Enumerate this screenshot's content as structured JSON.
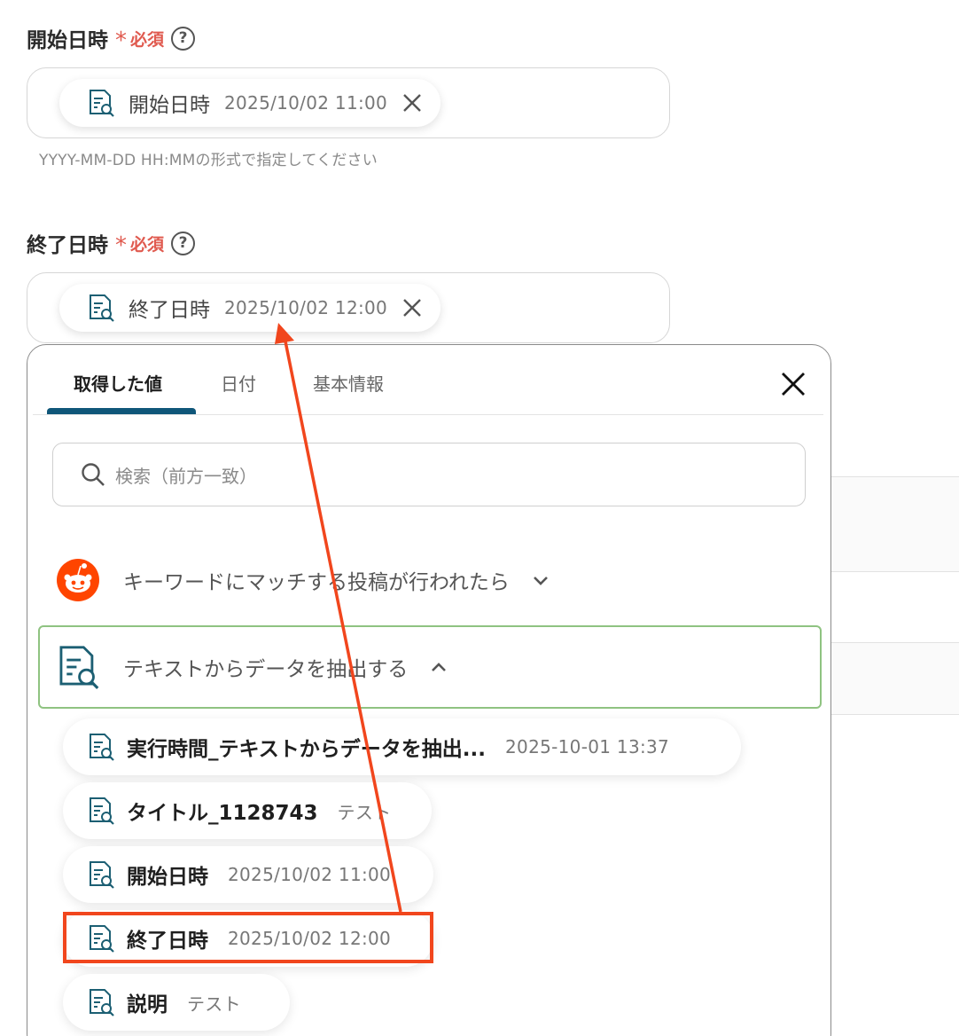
{
  "start_field": {
    "label": "開始日時",
    "required_mark": "*",
    "required_text": "必須",
    "help": "?",
    "chip_name": "開始日時",
    "chip_value": "2025/10/02 11:00",
    "hint": "YYYY-MM-DD HH:MMの形式で指定してください"
  },
  "end_field": {
    "label": "終了日時",
    "required_mark": "*",
    "required_text": "必須",
    "help": "?",
    "chip_name": "終了日時",
    "chip_value": "2025/10/02 12:00"
  },
  "panel": {
    "tabs": [
      "取得した値",
      "日付",
      "基本情報"
    ],
    "active_tab": "取得した値",
    "search_placeholder": "検索（前方一致）",
    "groups": [
      {
        "label": "キーワードにマッチする投稿が行われたら",
        "icon": "reddit-icon",
        "expanded": false
      },
      {
        "label": "テキストからデータを抽出する",
        "icon": "document-search-icon",
        "expanded": true
      }
    ],
    "items": [
      {
        "name": "実行時間_テキストからデータを抽出...",
        "value": "2025-10-01 13:37"
      },
      {
        "name": "タイトル_1128743",
        "value": "テスト"
      },
      {
        "name": "開始日時",
        "value": "2025/10/02 11:00"
      },
      {
        "name": "終了日時",
        "value": "2025/10/02 12:00"
      },
      {
        "name": "説明",
        "value": "テスト"
      }
    ]
  },
  "colors": {
    "required": "#e05a4f",
    "tab_underline": "#0f5679",
    "group_border": "#8fc381",
    "annotation": "#f1461d",
    "icon_teal": "#1c5f73"
  }
}
